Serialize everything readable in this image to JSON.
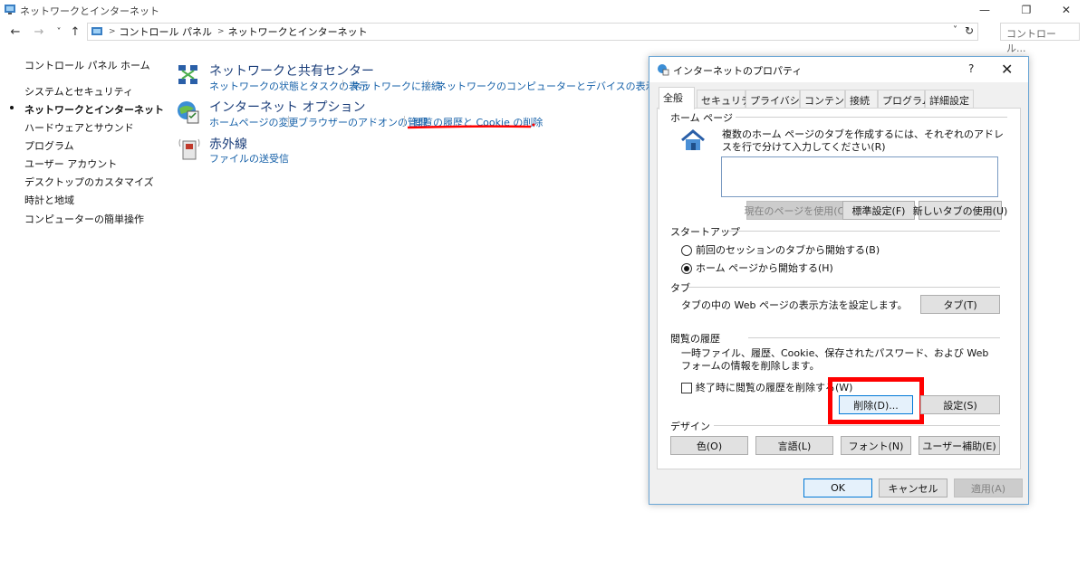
{
  "window": {
    "title": "ネットワークとインターネット",
    "minimize": "—",
    "maximize": "❐",
    "close": "✕"
  },
  "nav": {
    "back": "←",
    "forward": "→",
    "recent": "˅",
    "up": "↑",
    "breadcrumb": [
      "コントロール パネル",
      "ネットワークとインターネット"
    ],
    "dropdown": "˅",
    "refresh": "↻",
    "search_placeholder": "コントロール..."
  },
  "sidebar": {
    "home": "コントロール パネル ホーム",
    "items": [
      {
        "label": "システムとセキュリティ",
        "active": false
      },
      {
        "label": "ネットワークとインターネット",
        "active": true
      },
      {
        "label": "ハードウェアとサウンド",
        "active": false
      },
      {
        "label": "プログラム",
        "active": false
      },
      {
        "label": "ユーザー アカウント",
        "active": false
      },
      {
        "label": "デスクトップのカスタマイズ",
        "active": false
      },
      {
        "label": "時計と地域",
        "active": false
      },
      {
        "label": "コンピューターの簡単操作",
        "active": false
      }
    ]
  },
  "categories": [
    {
      "title": "ネットワークと共有センター",
      "links": [
        "ネットワークの状態とタスクの表示",
        "ネットワークに接続",
        "ネットワークのコンピューターとデバイスの表示"
      ]
    },
    {
      "title": "インターネット オプション",
      "links": [
        "ホームページの変更",
        "ブラウザーのアドオンの管理",
        "閲覧の履歴と Cookie の削除"
      ]
    },
    {
      "title": "赤外線",
      "links": [
        "ファイルの送受信"
      ]
    }
  ],
  "dialog": {
    "title": "インターネットのプロパティ",
    "help": "?",
    "close": "✕",
    "tabs": [
      "全般",
      "セキュリティ",
      "プライバシー",
      "コンテンツ",
      "接続",
      "プログラム",
      "詳細設定"
    ],
    "homepage": {
      "section": "ホーム ページ",
      "desc": "複数のホーム ページのタブを作成するには、それぞれのアドレスを行で分けて入力してください(R)",
      "value": "",
      "btn_current": "現在のページを使用(C)",
      "btn_default": "標準設定(F)",
      "btn_newtab": "新しいタブの使用(U)"
    },
    "startup": {
      "section": "スタートアップ",
      "option1": "前回のセッションのタブから開始する(B)",
      "option2": "ホーム ページから開始する(H)",
      "selected": 2
    },
    "tabs_section": {
      "section": "タブ",
      "desc": "タブの中の Web ページの表示方法を設定します。",
      "btn": "タブ(T)"
    },
    "history": {
      "section": "閲覧の履歴",
      "desc": "一時ファイル、履歴、Cookie、保存されたパスワード、および Web フォームの情報を削除します。",
      "checkbox": "終了時に閲覧の履歴を削除する(W)",
      "checked": false,
      "btn_delete": "削除(D)...",
      "btn_settings": "設定(S)"
    },
    "design": {
      "section": "デザイン",
      "btn_colors": "色(O)",
      "btn_languages": "言語(L)",
      "btn_fonts": "フォント(N)",
      "btn_accessibility": "ユーザー補助(E)"
    },
    "footer": {
      "ok": "OK",
      "cancel": "キャンセル",
      "apply": "適用(A)"
    }
  },
  "colors": {
    "link": "#1560a8",
    "category_title": "#1b3e7a",
    "highlight": "#ff0000",
    "dialog_border": "#6aa6d6"
  }
}
